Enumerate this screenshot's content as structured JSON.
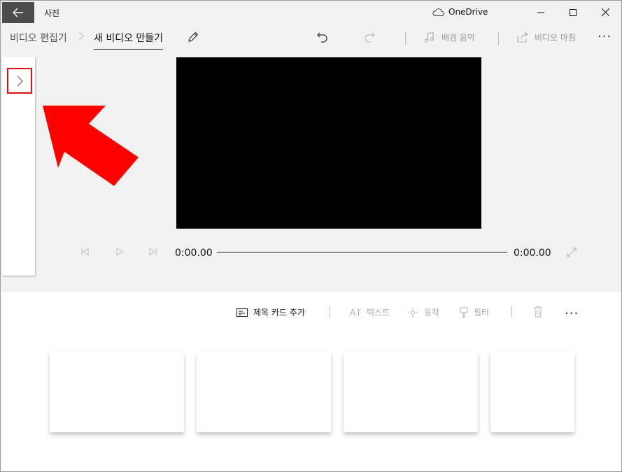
{
  "window": {
    "app_title": "사진",
    "cloud_label": "OneDrive"
  },
  "breadcrumb": {
    "parent": "비디오 편집기",
    "current": "새 비디오 만들기"
  },
  "toolbar": {
    "bg_music_label": "배경 음악",
    "finish_label": "비디오 마침",
    "more_label": "···"
  },
  "player": {
    "current_time": "0:00.00",
    "total_time": "0:00.00",
    "progress": 0
  },
  "storyboard": {
    "add_title_card_label": "제목 카드 추가",
    "text_label": "텍스트",
    "motion_label": "동작",
    "filter_label": "필터",
    "more_label": "···"
  },
  "colors": {
    "highlight": "#e01010",
    "arrow": "#ff0000"
  }
}
